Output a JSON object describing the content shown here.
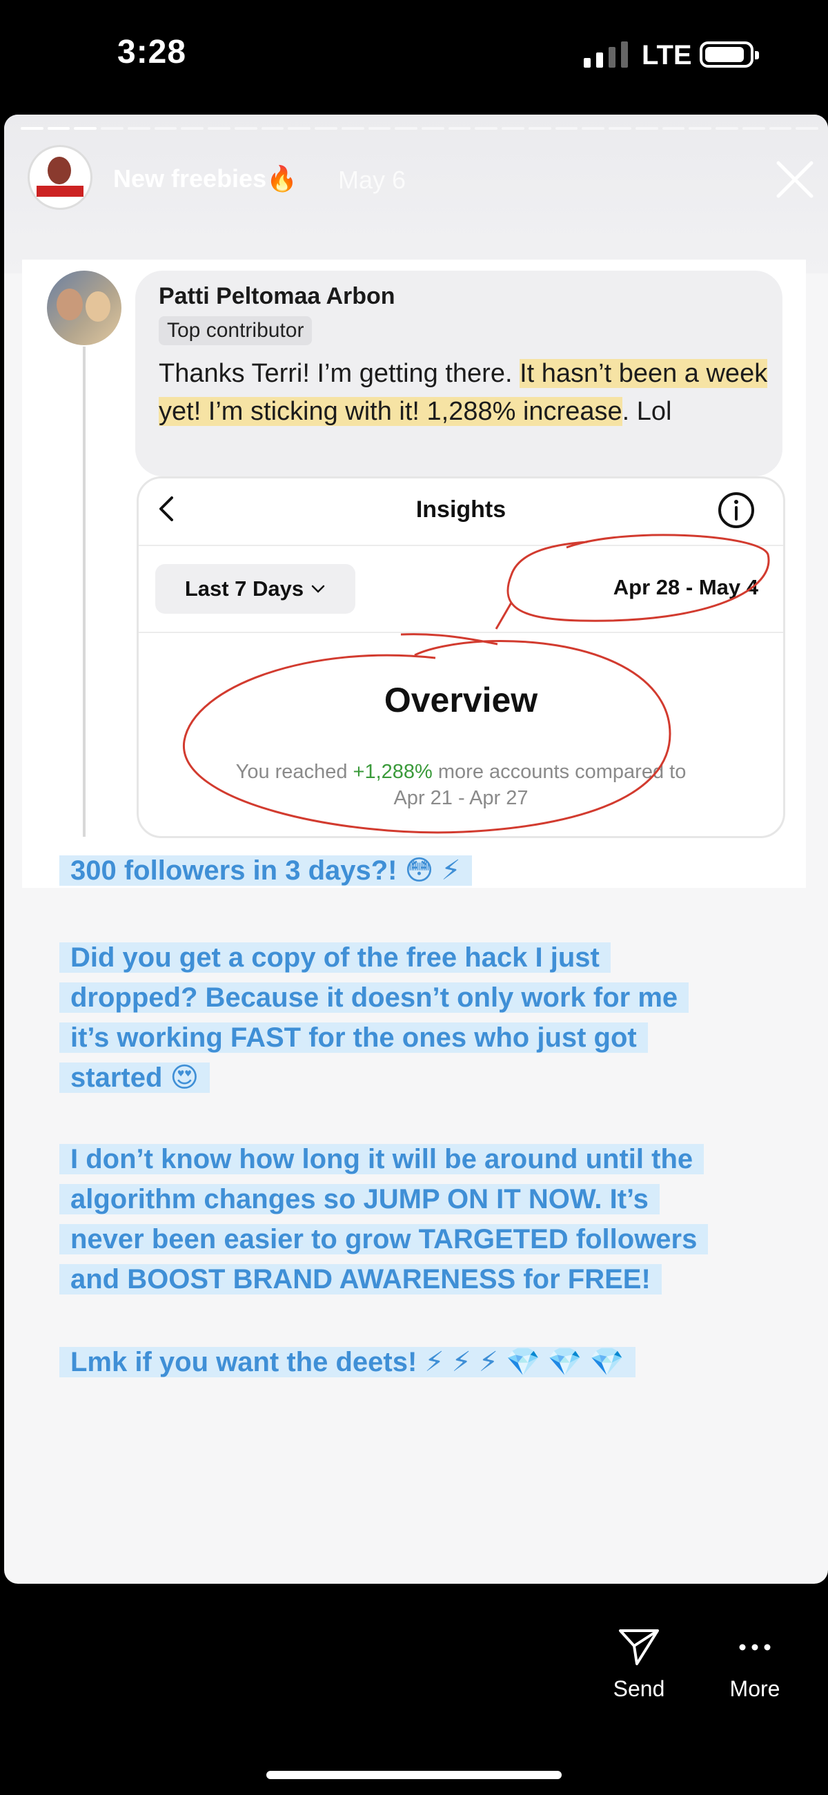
{
  "status_bar": {
    "time": "3:28",
    "network": "LTE"
  },
  "story": {
    "title": "New freebies",
    "title_emoji": "🔥",
    "date": "May 6",
    "segments_total": 30,
    "segments_done": 3
  },
  "post": {
    "author": "Patti Peltomaa Arbon",
    "badge": "Top contributor",
    "comment_plain": "Thanks Terri! I’m getting there. ",
    "comment_highlight": "It hasn’t been a week yet! I’m sticking with it! 1,288% increase",
    "comment_tail": ". Lol"
  },
  "insights": {
    "title": "Insights",
    "range_label": "Last 7 Days",
    "date_range": "Apr 28 - May 4",
    "overview_title": "Overview",
    "reach_prefix": "You reached ",
    "reach_percent": "+1,288%",
    "reach_suffix": " more accounts compared to",
    "compare_range": "Apr 21 - Apr 27"
  },
  "captions": {
    "c1": "300 followers in 3 days?! 😳 ⚡",
    "c2_l1": "Did you get a copy of the free hack I just",
    "c2_l2": "dropped? Because it doesn’t only work for me",
    "c2_l3": "it’s working FAST for the ones who just got",
    "c2_l4": "started 😍",
    "c3_l1": "I don’t know how long it will be around until the",
    "c3_l2": "algorithm changes so JUMP ON IT NOW. It’s",
    "c3_l3": "never been easier to grow TARGETED followers",
    "c3_l4": "and BOOST BRAND AWARENESS for FREE!",
    "c4": "Lmk if you want the deets! ⚡ ⚡ ⚡ 💎 💎 💎"
  },
  "actions": {
    "send": "Send",
    "more": "More"
  },
  "colors": {
    "caption_text": "#3f8fd6",
    "caption_bg": "#d7ecfb",
    "highlight": "#f6e3a4",
    "annotation": "#d23b2f",
    "increase_green": "#3a9a3a"
  },
  "icons": [
    "close-icon",
    "chevron-left-icon",
    "info-icon",
    "chevron-down-icon",
    "send-icon",
    "more-icon"
  ]
}
